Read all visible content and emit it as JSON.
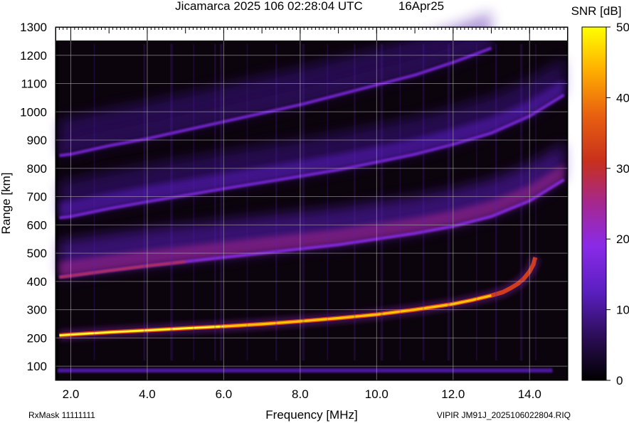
{
  "chart_data": {
    "type": "heatmap",
    "title": "Jicamarca 2025 106 02:28:04 UTC",
    "date_label": "16Apr25",
    "xlabel": "Frequency [MHz]",
    "ylabel": "Range [km]",
    "xlim": [
      1.6,
      15.0
    ],
    "ylim": [
      50,
      1300
    ],
    "x_ticks": [
      "2.0",
      "4.0",
      "6.0",
      "8.0",
      "10.0",
      "12.0",
      "14.0"
    ],
    "y_ticks": [
      "100",
      "200",
      "300",
      "400",
      "500",
      "600",
      "700",
      "800",
      "900",
      "1000",
      "1100",
      "1200",
      "1300"
    ],
    "grid": true,
    "colorbar": {
      "label": "SNR [dB]",
      "range": [
        0,
        50
      ],
      "ticks": [
        "0",
        "10",
        "20",
        "30",
        "40",
        "50"
      ]
    },
    "traces": [
      {
        "name": "o-trace first hop",
        "intensity_db": 40,
        "points": [
          [
            1.7,
            209
          ],
          [
            2.0,
            212
          ],
          [
            3.0,
            220
          ],
          [
            4.0,
            227
          ],
          [
            5.0,
            234
          ],
          [
            6.0,
            241
          ],
          [
            7.0,
            249
          ],
          [
            8.0,
            259
          ],
          [
            9.0,
            270
          ],
          [
            10.0,
            283
          ],
          [
            11.0,
            300
          ],
          [
            12.0,
            320
          ],
          [
            12.5,
            334
          ],
          [
            13.0,
            350
          ],
          [
            13.3,
            362
          ],
          [
            13.5,
            376
          ],
          [
            13.7,
            392
          ],
          [
            13.85,
            410
          ],
          [
            14.0,
            435
          ],
          [
            14.1,
            460
          ],
          [
            14.15,
            485
          ]
        ]
      },
      {
        "name": "second hop",
        "intensity_db": 25,
        "points": [
          [
            1.7,
            415
          ],
          [
            2.0,
            420
          ],
          [
            3.0,
            438
          ],
          [
            4.0,
            455
          ],
          [
            5.0,
            470
          ],
          [
            6.0,
            485
          ],
          [
            7.0,
            500
          ],
          [
            8.0,
            515
          ],
          [
            9.0,
            530
          ],
          [
            10.0,
            550
          ],
          [
            11.0,
            570
          ],
          [
            12.0,
            595
          ],
          [
            13.0,
            630
          ],
          [
            14.0,
            685
          ],
          [
            14.9,
            760
          ]
        ]
      },
      {
        "name": "third hop",
        "intensity_db": 14,
        "points": [
          [
            1.7,
            625
          ],
          [
            2.0,
            630
          ],
          [
            3.0,
            658
          ],
          [
            4.0,
            682
          ],
          [
            5.0,
            705
          ],
          [
            6.0,
            728
          ],
          [
            7.0,
            750
          ],
          [
            8.0,
            772
          ],
          [
            9.0,
            795
          ],
          [
            10.0,
            822
          ],
          [
            11.0,
            850
          ],
          [
            12.0,
            885
          ],
          [
            13.0,
            925
          ],
          [
            14.0,
            985
          ],
          [
            14.9,
            1060
          ]
        ]
      },
      {
        "name": "fourth hop",
        "intensity_db": 8,
        "points": [
          [
            1.7,
            845
          ],
          [
            2.0,
            850
          ],
          [
            3.0,
            880
          ],
          [
            4.0,
            905
          ],
          [
            5.0,
            935
          ],
          [
            6.0,
            965
          ],
          [
            7.0,
            995
          ],
          [
            8.0,
            1025
          ],
          [
            9.0,
            1060
          ],
          [
            10.0,
            1095
          ],
          [
            11.0,
            1130
          ],
          [
            12.0,
            1175
          ],
          [
            13.0,
            1225
          ]
        ]
      }
    ],
    "noise_band": {
      "range_km": 85,
      "intensity_db": 7
    }
  },
  "footer": {
    "rxmask": "RxMask 11111111",
    "file": "VIPIR  JM91J_2025106022804.RIQ"
  },
  "colors": {
    "background": "#000000",
    "plot_bg": "#0b040c",
    "grid": "#b4b4b4",
    "colormap": [
      "#000000",
      "#2a0d54",
      "#5a1fc0",
      "#8a2ae8",
      "#a52890",
      "#c8301c",
      "#e86010",
      "#ffb000",
      "#ffff00"
    ]
  }
}
